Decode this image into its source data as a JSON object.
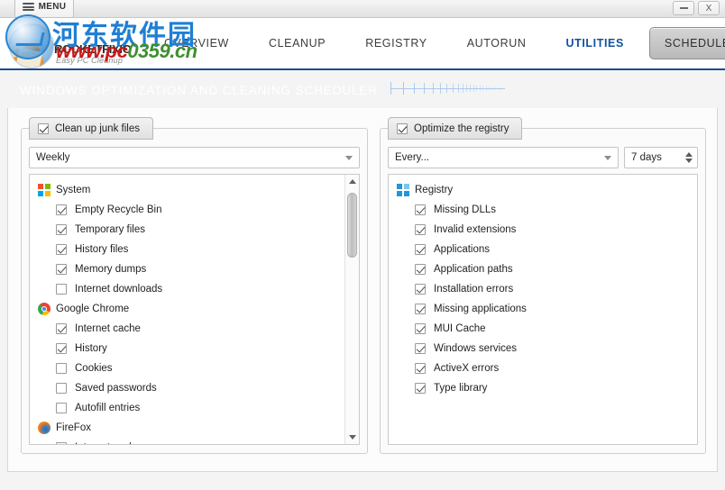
{
  "window": {
    "menu_label": "MENU",
    "minimize_label": "—",
    "close_label": "X"
  },
  "brand": {
    "name": "ROCKETFIXIO",
    "tagline": "Easy PC Cleanup"
  },
  "nav": {
    "items": [
      {
        "label": "OVERVIEW",
        "state": "normal"
      },
      {
        "label": "CLEANUP",
        "state": "normal"
      },
      {
        "label": "REGISTRY",
        "state": "normal"
      },
      {
        "label": "AUTORUN",
        "state": "normal"
      },
      {
        "label": "UTILITIES",
        "state": "link-active"
      },
      {
        "label": "SCHEDULER",
        "state": "current-tab"
      }
    ]
  },
  "banner": {
    "title": "WINDOWS OPTIMIZATION AND CLEANING SCHEDULER"
  },
  "watermark": {
    "chinese": "河东软件园",
    "url_red": "www.pc",
    "url_green": "0359.cn"
  },
  "left_panel": {
    "tab_label": "Clean up junk files",
    "tab_checked": true,
    "schedule_value": "Weekly",
    "groups": [
      {
        "name": "System",
        "icon": "windows-icon",
        "items": [
          {
            "label": "Empty Recycle Bin",
            "checked": true
          },
          {
            "label": "Temporary files",
            "checked": true
          },
          {
            "label": "History files",
            "checked": true
          },
          {
            "label": "Memory dumps",
            "checked": true
          },
          {
            "label": "Internet downloads",
            "checked": false
          }
        ]
      },
      {
        "name": "Google Chrome",
        "icon": "chrome-icon",
        "items": [
          {
            "label": "Internet cache",
            "checked": true
          },
          {
            "label": "History",
            "checked": true
          },
          {
            "label": "Cookies",
            "checked": false
          },
          {
            "label": "Saved passwords",
            "checked": false
          },
          {
            "label": "Autofill entries",
            "checked": false
          }
        ]
      },
      {
        "name": "FireFox",
        "icon": "firefox-icon",
        "items": [
          {
            "label": "Internet cache",
            "checked": true
          }
        ]
      }
    ]
  },
  "right_panel": {
    "tab_label": "Optimize the registry",
    "tab_checked": true,
    "schedule_value": "Every...",
    "interval_value": "7 days",
    "groups": [
      {
        "name": "Registry",
        "icon": "registry-icon",
        "items": [
          {
            "label": "Missing DLLs",
            "checked": true
          },
          {
            "label": "Invalid extensions",
            "checked": true
          },
          {
            "label": "Applications",
            "checked": true
          },
          {
            "label": "Application paths",
            "checked": true
          },
          {
            "label": "Installation errors",
            "checked": true
          },
          {
            "label": "Missing applications",
            "checked": true
          },
          {
            "label": "MUI Cache",
            "checked": true
          },
          {
            "label": "Windows services",
            "checked": true
          },
          {
            "label": "ActiveX errors",
            "checked": true
          },
          {
            "label": "Type library",
            "checked": true
          }
        ]
      }
    ]
  },
  "colors": {
    "banner_blue": "#17458a",
    "accent_link": "#12529e",
    "watermark_blue": "#1f7fd4",
    "watermark_red": "#c81a1a",
    "watermark_green": "#3f8f2f"
  }
}
